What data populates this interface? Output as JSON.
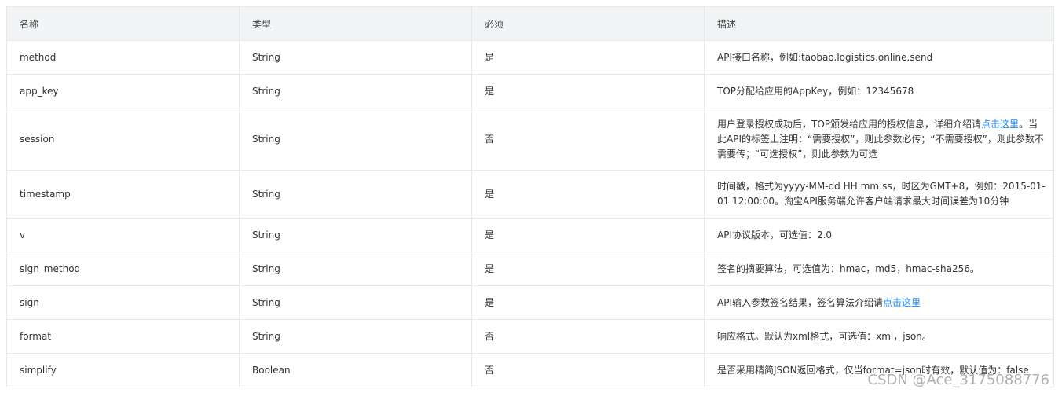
{
  "table": {
    "headers": [
      "名称",
      "类型",
      "必须",
      "描述"
    ],
    "rows": [
      {
        "name": "method",
        "type": "String",
        "required": "是",
        "desc_a": "API接口名称，例如:taobao.logistics.online.send"
      },
      {
        "name": "app_key",
        "type": "String",
        "required": "是",
        "desc_a": "TOP分配给应用的AppKey，例如：12345678"
      },
      {
        "name": "session",
        "type": "String",
        "required": "否",
        "desc_a": "用户登录授权成功后，TOP颁发给应用的授权信息，详细介绍请",
        "link": "点击这里",
        "desc_b": "。当此API的标签上注明：“需要授权”，则此参数必传；“不需要授权”，则此参数不需要传；“可选授权”，则此参数为可选"
      },
      {
        "name": "timestamp",
        "type": "String",
        "required": "是",
        "desc_a": "时间戳，格式为yyyy-MM-dd HH:mm:ss，时区为GMT+8，例如：2015-01-01 12:00:00。淘宝API服务端允许客户端请求最大时间误差为10分钟"
      },
      {
        "name": "v",
        "type": "String",
        "required": "是",
        "desc_a": "API协议版本，可选值：2.0"
      },
      {
        "name": "sign_method",
        "type": "String",
        "required": "是",
        "desc_a": "签名的摘要算法，可选值为：hmac，md5，hmac-sha256。"
      },
      {
        "name": "sign",
        "type": "String",
        "required": "是",
        "desc_a": "API输入参数签名结果，签名算法介绍请",
        "link": "点击这里"
      },
      {
        "name": "format",
        "type": "String",
        "required": "否",
        "desc_a": "响应格式。默认为xml格式，可选值：xml，json。"
      },
      {
        "name": "simplify",
        "type": "Boolean",
        "required": "否",
        "desc_a": "是否采用精简JSON返回格式，仅当format=json时有效，默认值为：false"
      }
    ]
  },
  "watermark": "CSDN @Ace_3175088776",
  "colors": {
    "header_bg": "#f2f4f5",
    "border": "#e8e8e8",
    "link": "#1a8cff",
    "text": "#333333"
  }
}
